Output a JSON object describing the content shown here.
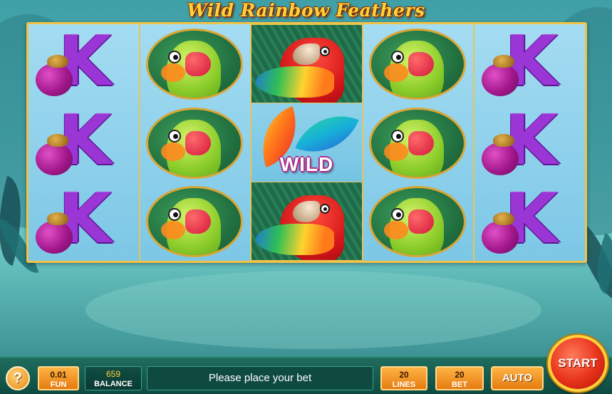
{
  "game": {
    "title": "Wild Rainbow Feathers"
  },
  "reels": [
    [
      "k-mangosteen",
      "k-mangosteen",
      "k-mangosteen"
    ],
    [
      "green-parrot",
      "green-parrot",
      "green-parrot"
    ],
    [
      "red-parrot",
      "wild",
      "red-parrot"
    ],
    [
      "green-parrot",
      "green-parrot",
      "green-parrot"
    ],
    [
      "k-mangosteen",
      "k-mangosteen",
      "k-mangosteen"
    ]
  ],
  "symbols": {
    "k_letter": "K",
    "wild_label": "WILD"
  },
  "bottom_bar": {
    "help_label": "?",
    "coin": {
      "value": "0.01",
      "label": "FUN"
    },
    "balance": {
      "value": "659",
      "label": "BALANCE"
    },
    "message": "Please place your bet",
    "lines": {
      "value": "20",
      "label": "LINES"
    },
    "bet": {
      "value": "20",
      "label": "BET"
    },
    "auto_label": "AUTO",
    "start_label": "START"
  },
  "colors": {
    "accent": "#ffd23a",
    "button_orange": "#e57b10",
    "start_red": "#e8321a"
  }
}
